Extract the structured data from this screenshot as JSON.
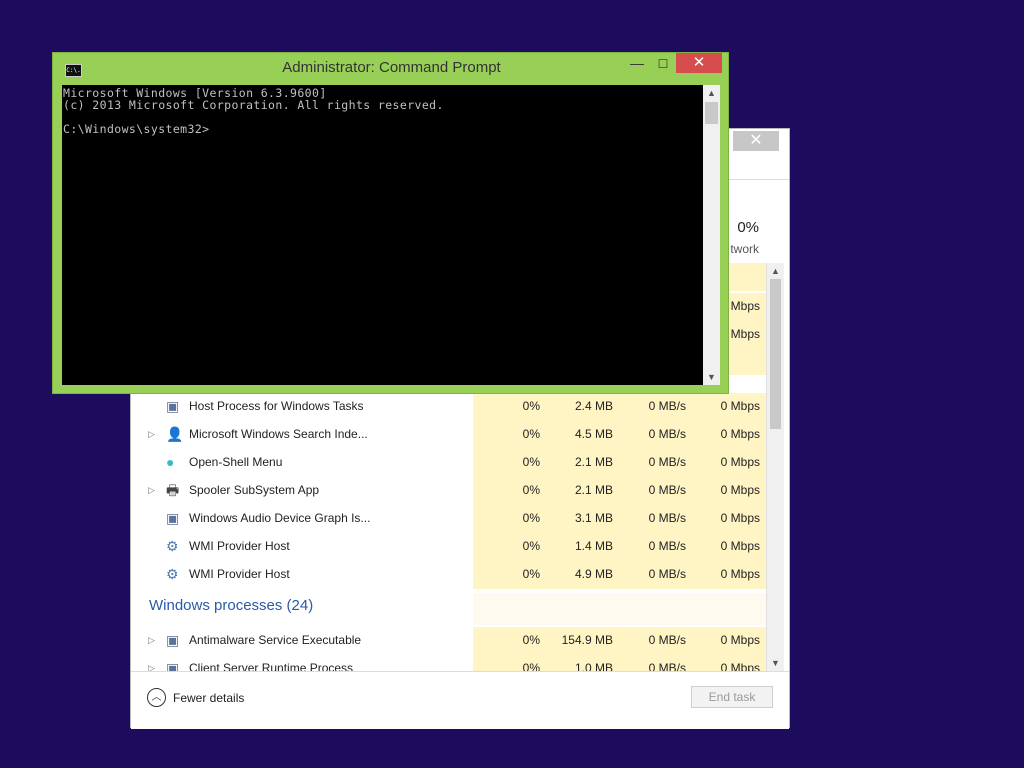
{
  "taskmgr": {
    "close_glyph": "✕",
    "network_pct": "0%",
    "network_label": "Network",
    "header_fragment": "twork",
    "partial_rows": [
      {
        "network": "0 Mbps"
      },
      {
        "network": "0 Mbps"
      }
    ],
    "rows": [
      {
        "name": "Host Process for Windows Tasks",
        "icon": "window-app-icon",
        "expandable": false,
        "cpu": "0%",
        "memory": "2.4 MB",
        "disk": "0 MB/s",
        "network": "0 Mbps"
      },
      {
        "name": "Microsoft Windows Search Inde...",
        "icon": "search-indexer-icon",
        "expandable": true,
        "cpu": "0%",
        "memory": "4.5 MB",
        "disk": "0 MB/s",
        "network": "0 Mbps"
      },
      {
        "name": "Open-Shell Menu",
        "icon": "shell-orb-icon",
        "expandable": false,
        "cpu": "0%",
        "memory": "2.1 MB",
        "disk": "0 MB/s",
        "network": "0 Mbps"
      },
      {
        "name": "Spooler SubSystem App",
        "icon": "printer-icon",
        "expandable": true,
        "cpu": "0%",
        "memory": "2.1 MB",
        "disk": "0 MB/s",
        "network": "0 Mbps"
      },
      {
        "name": "Windows Audio Device Graph Is...",
        "icon": "window-app-icon",
        "expandable": false,
        "cpu": "0%",
        "memory": "3.1 MB",
        "disk": "0 MB/s",
        "network": "0 Mbps"
      },
      {
        "name": "WMI Provider Host",
        "icon": "wmi-icon",
        "expandable": false,
        "cpu": "0%",
        "memory": "1.4 MB",
        "disk": "0 MB/s",
        "network": "0 Mbps"
      },
      {
        "name": "WMI Provider Host",
        "icon": "wmi-icon",
        "expandable": false,
        "cpu": "0%",
        "memory": "4.9 MB",
        "disk": "0 MB/s",
        "network": "0 Mbps"
      }
    ],
    "group": {
      "label": "Windows processes (24)"
    },
    "group_rows": [
      {
        "name": "Antimalware Service Executable",
        "icon": "window-app-icon",
        "expandable": true,
        "cpu": "0%",
        "memory": "154.9 MB",
        "disk": "0 MB/s",
        "network": "0 Mbps"
      },
      {
        "name": "Client Server Runtime Process",
        "icon": "window-app-icon",
        "expandable": true,
        "cpu": "0%",
        "memory": "1.0 MB",
        "disk": "0 MB/s",
        "network": "0 Mbps"
      }
    ],
    "footer": {
      "fewer_details_label": "Fewer details",
      "end_task_label": "End task"
    },
    "colors": {
      "highlight": "#fff4c4",
      "group_text": "#2a5aa8"
    }
  },
  "cmd": {
    "title": "Administrator:  Command Prompt",
    "icon_text": "C:\\.",
    "minimize_glyph": "—",
    "maximize_glyph": "☐",
    "close_glyph": "✕",
    "console_lines": [
      "Microsoft Windows [Version 6.3.9600]",
      "(c) 2013 Microsoft Corporation. All rights reserved.",
      "",
      "C:\\Windows\\system32>"
    ],
    "colors": {
      "frame": "#98cf56",
      "close": "#d74c4c",
      "console_bg": "#000000",
      "console_text": "#c0c0c0"
    }
  }
}
